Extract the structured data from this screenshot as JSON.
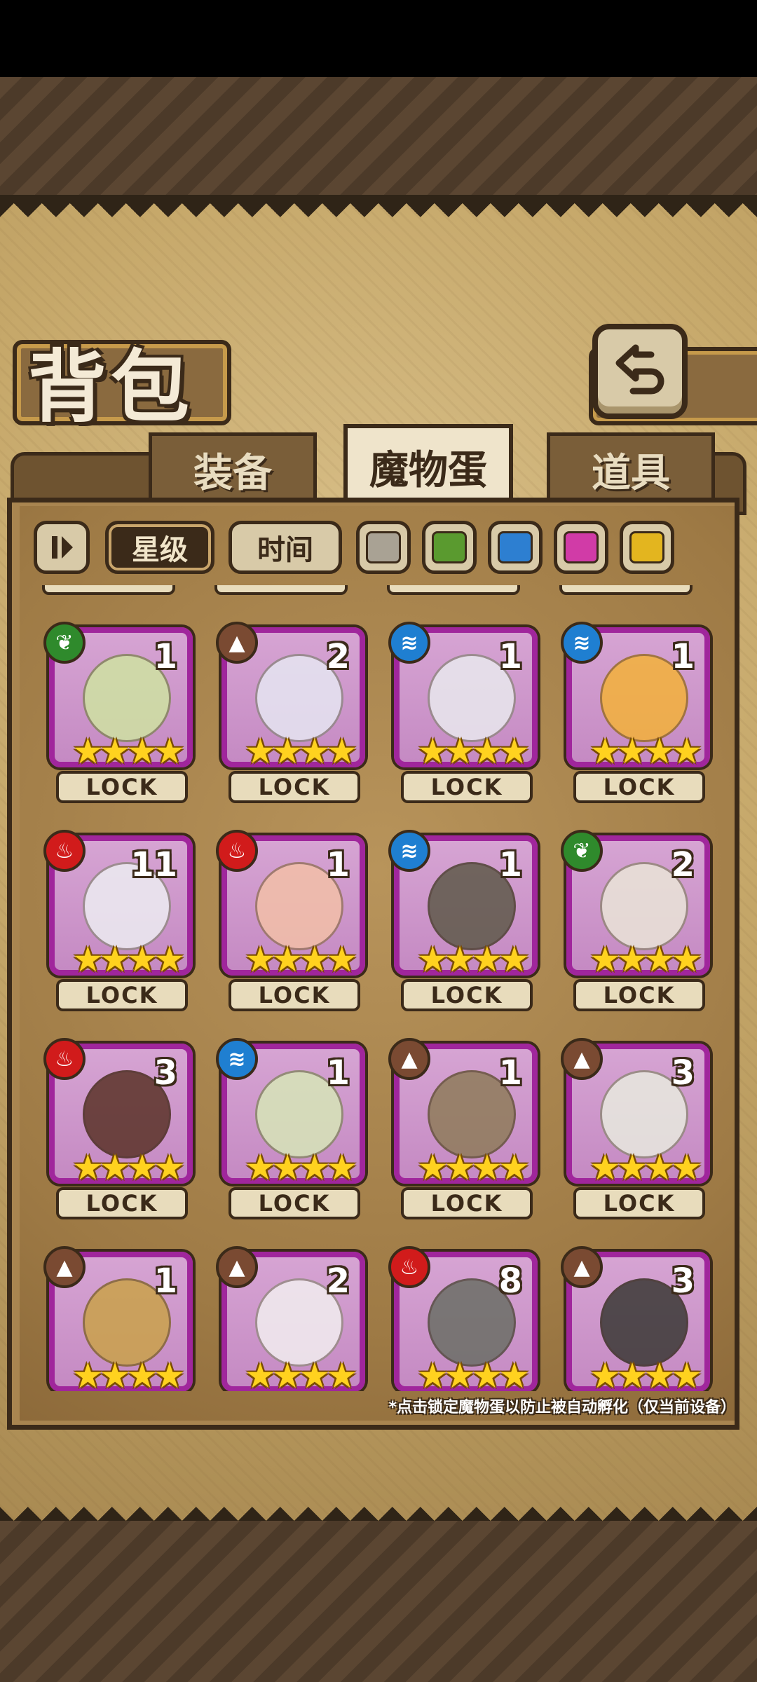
{
  "header": {
    "title": "背包"
  },
  "tabs": [
    {
      "label": "装备",
      "active": false
    },
    {
      "label": "魔物蛋",
      "active": true
    },
    {
      "label": "道具",
      "active": false
    }
  ],
  "filters": {
    "star_label": "星级",
    "time_label": "时间",
    "colors": [
      "#a9a294",
      "#5a9a2f",
      "#2d7fd1",
      "#d13ba7",
      "#e3b51f"
    ]
  },
  "lock_label": "LOCK",
  "items": [
    {
      "element": "leaf",
      "count": "1",
      "stars": 4,
      "egg_color": "#cfe3a2"
    },
    {
      "element": "earth",
      "count": "2",
      "stars": 4,
      "egg_color": "#e6e6f2"
    },
    {
      "element": "water",
      "count": "1",
      "stars": 4,
      "egg_color": "#e9e9ee"
    },
    {
      "element": "water",
      "count": "1",
      "stars": 4,
      "egg_color": "#f4b23a"
    },
    {
      "element": "fire",
      "count": "11",
      "stars": 4,
      "egg_color": "#ededf2"
    },
    {
      "element": "fire",
      "count": "1",
      "stars": 4,
      "egg_color": "#f3c0a8"
    },
    {
      "element": "water",
      "count": "1",
      "stars": 4,
      "egg_color": "#5f5a4a"
    },
    {
      "element": "leaf",
      "count": "2",
      "stars": 4,
      "egg_color": "#eae5d8"
    },
    {
      "element": "fire",
      "count": "3",
      "stars": 4,
      "egg_color": "#5b3328"
    },
    {
      "element": "water",
      "count": "1",
      "stars": 4,
      "egg_color": "#d7e6b8"
    },
    {
      "element": "earth",
      "count": "1",
      "stars": 4,
      "egg_color": "#8f7c5a"
    },
    {
      "element": "earth",
      "count": "3",
      "stars": 4,
      "egg_color": "#e8eadf"
    },
    {
      "element": "earth",
      "count": "1",
      "stars": 4,
      "egg_color": "#caa24a"
    },
    {
      "element": "earth",
      "count": "2",
      "stars": 4,
      "egg_color": "#f2eef0"
    },
    {
      "element": "fire",
      "count": "8",
      "stars": 4,
      "egg_color": "#6b6f66"
    },
    {
      "element": "earth",
      "count": "3",
      "stars": 4,
      "egg_color": "#3b3a36"
    }
  ],
  "hint": "*点击锁定魔物蛋以防止被自动孵化（仅当前设备）"
}
